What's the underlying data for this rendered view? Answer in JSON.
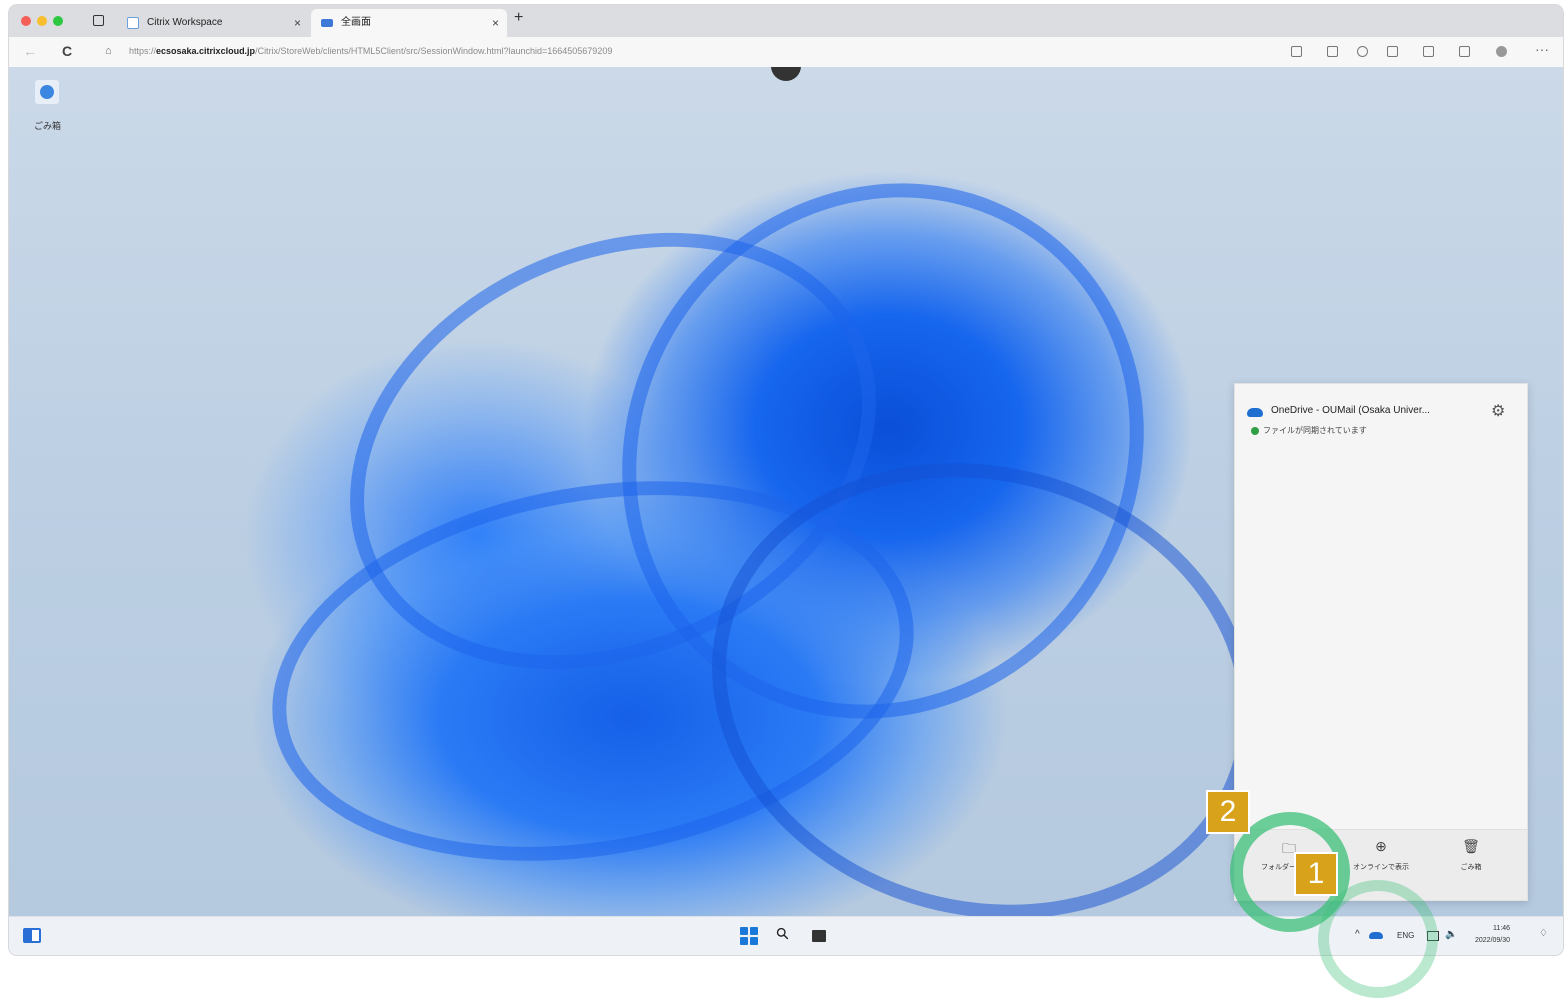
{
  "browser": {
    "tabs": [
      {
        "title": "Citrix Workspace",
        "close": "×"
      },
      {
        "title": "全画面",
        "close": "×"
      }
    ],
    "new_tab": "+",
    "url_prefix": "https://",
    "url_host": "ecsosaka.citrixcloud.jp",
    "url_path": "/Citrix/StoreWeb/clients/HTML5Client/src/SessionWindow.html?launchid=1664505679209",
    "back": "←",
    "reload": "C"
  },
  "desktop": {
    "icon_label": "ごみ箱"
  },
  "onedrive_panel": {
    "title": "OneDrive - OUMail (Osaka Univer...",
    "status": "ファイルが同期されています",
    "gear": "⚙",
    "buttons": [
      {
        "icon": "folder-icon",
        "glyph": "🗀",
        "label": "フォルダーを開く"
      },
      {
        "icon": "globe-icon",
        "glyph": "⊕",
        "label": "オンラインで表示"
      },
      {
        "icon": "trash-icon",
        "glyph": "🗑",
        "label": "ごみ箱"
      }
    ]
  },
  "taskbar": {
    "tray_chevron": "^",
    "ime": "ENG",
    "volume": "🔈",
    "time": "11:46",
    "date": "2022/09/30"
  },
  "annotations": {
    "badge_1": "1",
    "badge_2": "2",
    "ring_color": "#3cbf78",
    "badge_color": "#d8a31b"
  }
}
